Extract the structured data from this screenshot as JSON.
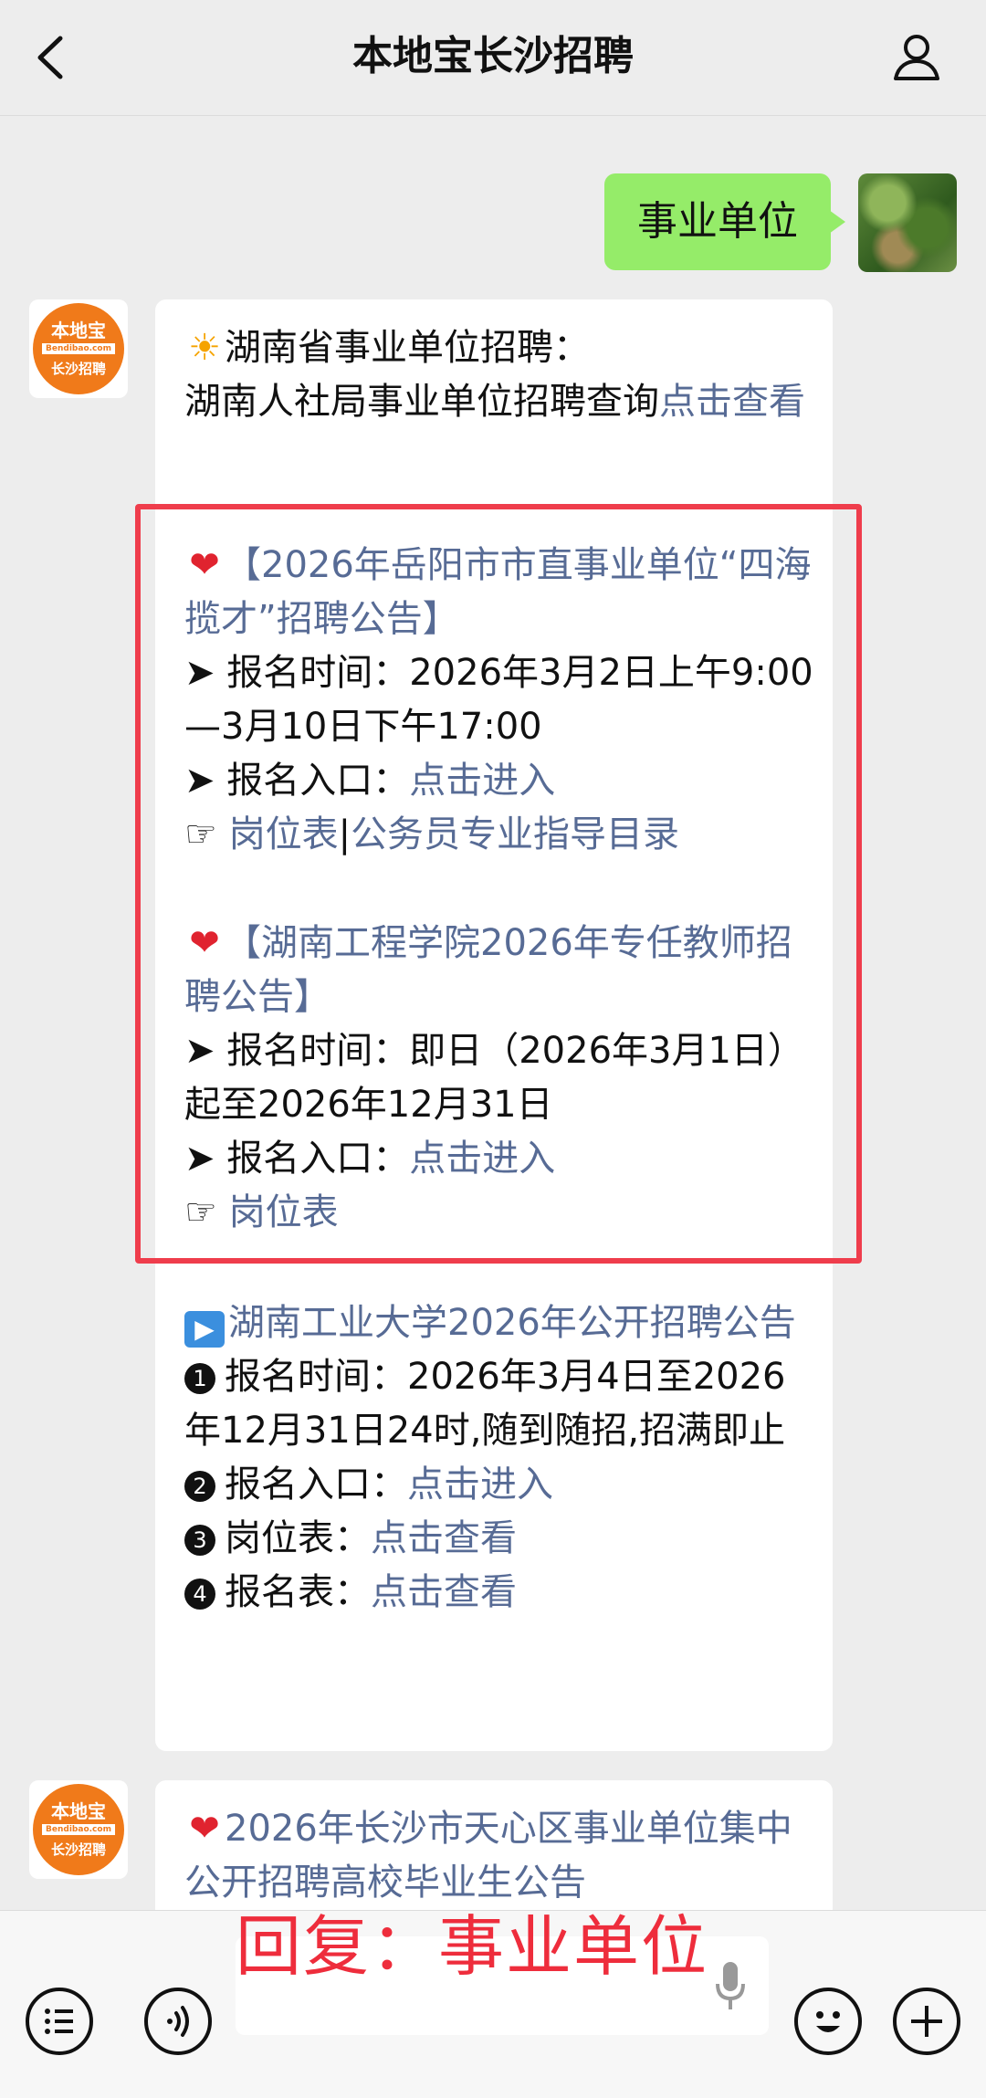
{
  "header": {
    "title": "本地宝长沙招聘"
  },
  "my_message": {
    "text": "事业单位"
  },
  "bot_logo": {
    "line1": "本地宝",
    "line2": "Bendibao.com",
    "line3": "长沙招聘"
  },
  "message1": {
    "intro_title": "湖南省事业单位招聘：",
    "intro_text": "湖南人社局事业单位招聘查询",
    "intro_link": "点击查看",
    "job1": {
      "title": "【2026年岳阳市市直事业单位“四海揽才”招聘公告】",
      "time_label": "➤ 报名时间：",
      "time_value": "2026年3月2日上午9:00—3月10日下午17:00",
      "entry_label": "➤ 报名入口：",
      "entry_link": "点击进入",
      "links_prefix": "☞",
      "link_a": "岗位表",
      "link_sep": "|",
      "link_b": "公务员专业指导目录"
    },
    "job2": {
      "title": "【湖南工程学院2026年专任教师招聘公告】",
      "time_label": "➤ 报名时间：",
      "time_value": "即日（2026年3月1日）起至2026年12月31日",
      "entry_label": "➤ 报名入口：",
      "entry_link": "点击进入",
      "links_prefix": "☞",
      "link_a": "岗位表"
    },
    "job3": {
      "title": "湖南工业大学2026年公开招聘公告",
      "time_label": "报名时间：",
      "time_value": "2026年3月4日至2026年12月31日24时,随到随招,招满即止",
      "entry_label": "报名入口：",
      "entry_link": "点击进入",
      "table_label": "岗位表：",
      "table_link": "点击查看",
      "form_label": "报名表：",
      "form_link": "点击查看"
    }
  },
  "message2": {
    "title": "2026年长沙市天心区事业单位集中公开招聘高校毕业生公告"
  },
  "overlay": {
    "text": "回复：事业单位"
  },
  "colors": {
    "link": "#576b95",
    "my_bubble": "#95ec69",
    "highlight_border": "#ef3d4c",
    "overlay_text": "#ee2d3c"
  }
}
